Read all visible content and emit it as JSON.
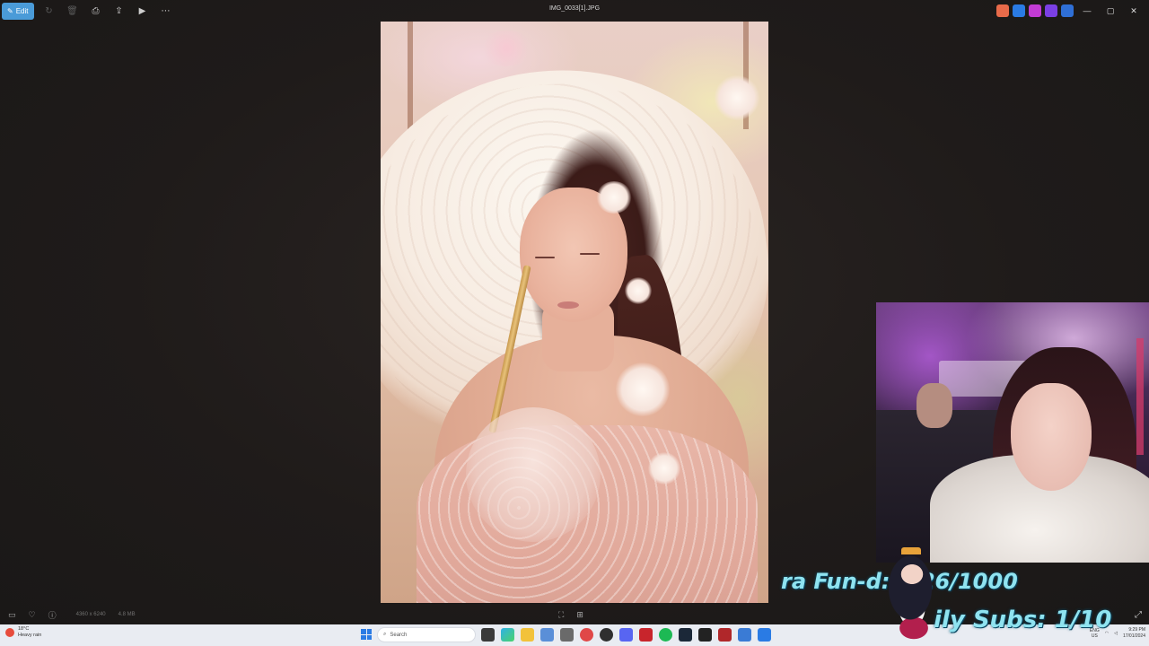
{
  "window": {
    "title": "IMG_0033[1].JPG",
    "toolbar": {
      "edit_label": "Edit"
    }
  },
  "statusbar": {
    "dimensions": "4360 x 6240",
    "filesize": "4.8 MB"
  },
  "taskbar": {
    "weather_temp": "18°C",
    "weather_desc": "Heavy rain",
    "search_placeholder": "Search",
    "tray_lang_1": "ENG",
    "tray_lang_2": "US",
    "time": "9:29 PM",
    "date": "17/01/2024"
  },
  "stream_overlay": {
    "fund_text": "ra Fun-d: $ 26/1000",
    "subs_text": "ily Subs: 1/10"
  },
  "colors": {
    "accent": "#4a9bd8",
    "overlay_text": "#8fe3f0"
  }
}
